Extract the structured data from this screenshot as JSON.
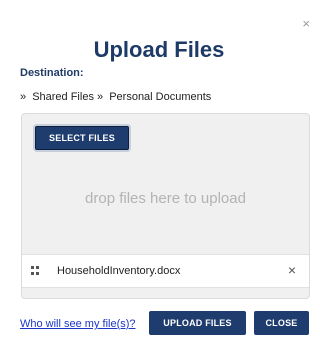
{
  "dialog": {
    "close_icon": "×",
    "title": "Upload Files",
    "destination_label": "Destination:",
    "breadcrumb": [
      {
        "sep": "»",
        "label": "Shared Files"
      },
      {
        "sep": "»",
        "label": "Personal Documents"
      }
    ]
  },
  "dropzone": {
    "select_label": "SELECT FILES",
    "hint": "drop files here to upload",
    "files": [
      {
        "name": "HouseholdInventory.docx",
        "remove_icon": "×",
        "handle_icon": "drag-handle-icon"
      }
    ]
  },
  "footer": {
    "who_link": "Who will see my file(s)?",
    "upload_label": "UPLOAD FILES",
    "close_label": "CLOSE"
  },
  "colors": {
    "accent": "#1f3c6e",
    "title": "#1e3a66",
    "link": "#1a35c8",
    "panel_bg": "#f0f0f0"
  }
}
